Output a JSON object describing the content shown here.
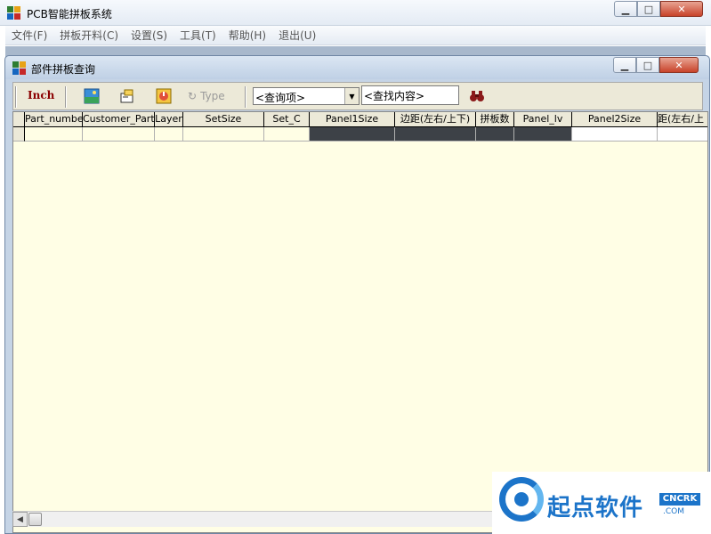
{
  "app": {
    "title": "PCB智能拼板系统",
    "menu": [
      "文件(F)",
      "拼板开料(C)",
      "设置(S)",
      "工具(T)",
      "帮助(H)",
      "退出(U)"
    ]
  },
  "child_window": {
    "title": "部件拼板查询"
  },
  "toolbar": {
    "inch_label": "Inch",
    "type_label": "Type",
    "query_select": "<查询项>",
    "search_value": "<查找内容>"
  },
  "grid": {
    "columns": [
      "Part_number",
      "Customer_Part",
      "Layer",
      "SetSize",
      "Set_C",
      "Panel1Size",
      "边距(左右/上下)",
      "拼板数",
      "Panel_lv",
      "Panel2Size",
      "距(左右/上"
    ]
  },
  "watermark": {
    "brand": "起点软件",
    "badge": "CNCRK",
    "sub": ".COM"
  },
  "colors": {
    "grid_bg": "#fffee5",
    "selected_cell": "#3d4147",
    "inch_color": "#8b0000",
    "brand_blue": "#1c74c9"
  }
}
